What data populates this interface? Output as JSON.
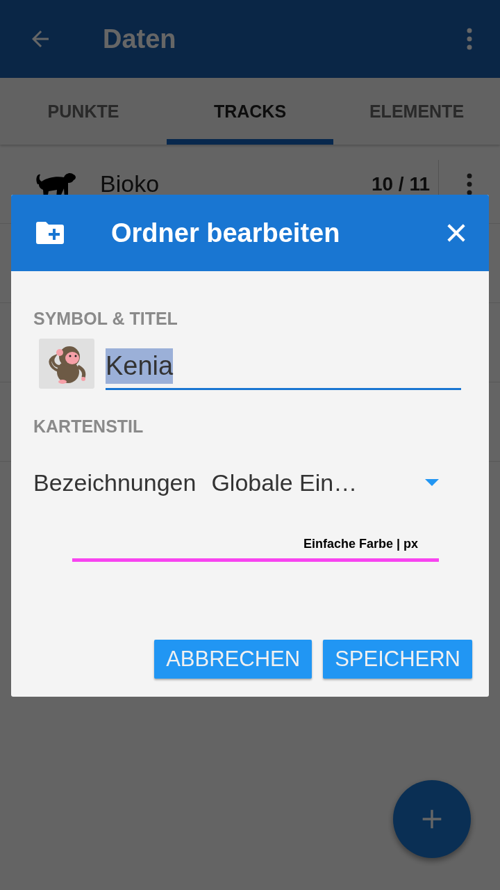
{
  "app_bar": {
    "title": "Daten"
  },
  "tabs": [
    {
      "label": "PUNKTE",
      "selected": false
    },
    {
      "label": "TRACKS",
      "selected": true
    },
    {
      "label": "ELEMENTE",
      "selected": false
    }
  ],
  "rows": [
    {
      "name": "Bioko",
      "count": "10 / 11"
    }
  ],
  "dialog": {
    "title": "Ordner bearbeiten",
    "section_label": "SYMBOL & TITEL",
    "title_field": {
      "value": "Kenia"
    },
    "style_label": "KARTENSTIL",
    "labels_setting": {
      "label": "Bezeichnungen",
      "value": "Globale Ein…"
    },
    "line_preview": {
      "caption": "Einfache Farbe | px"
    },
    "buttons": [
      "ABBRECHEN",
      "SPEICHERN"
    ]
  }
}
